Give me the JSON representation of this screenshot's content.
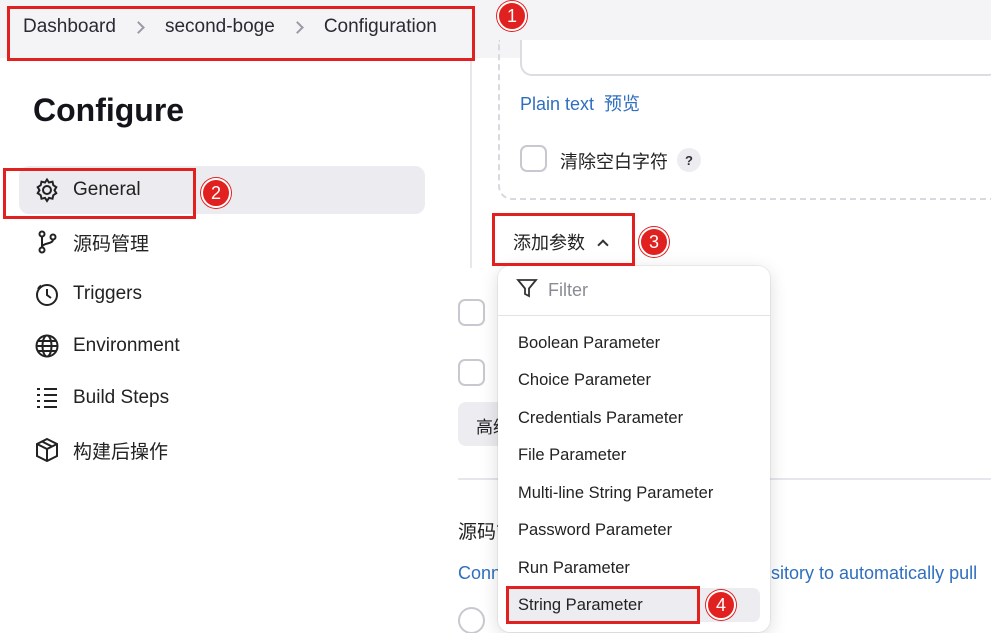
{
  "breadcrumb": {
    "items": [
      "Dashboard",
      "second-boge",
      "Configuration"
    ]
  },
  "sidebar": {
    "heading": "Configure",
    "items": [
      {
        "label": "General",
        "icon": "gear-icon"
      },
      {
        "label": "源码管理",
        "icon": "branch-icon"
      },
      {
        "label": "Triggers",
        "icon": "timer-icon"
      },
      {
        "label": "Environment",
        "icon": "globe-icon"
      },
      {
        "label": "Build Steps",
        "icon": "list-icon"
      },
      {
        "label": "构建后操作",
        "icon": "package-icon"
      }
    ]
  },
  "content": {
    "plain_text": "Plain text",
    "preview": "预览",
    "trim_label": "清除空白字符",
    "help": "?",
    "add_param": "添加参数",
    "advanced": "高级",
    "section_head": "源码管理",
    "conn_text_left": "Conn",
    "conn_text_right": "sitory to automatically pull"
  },
  "dropdown": {
    "filter_placeholder": "Filter",
    "items": [
      "Boolean Parameter",
      "Choice Parameter",
      "Credentials Parameter",
      "File Parameter",
      "Multi-line String Parameter",
      "Password Parameter",
      "Run Parameter",
      "String Parameter"
    ]
  },
  "annotations": {
    "markers": [
      "1",
      "2",
      "3",
      "4"
    ],
    "color": "#e12020"
  }
}
